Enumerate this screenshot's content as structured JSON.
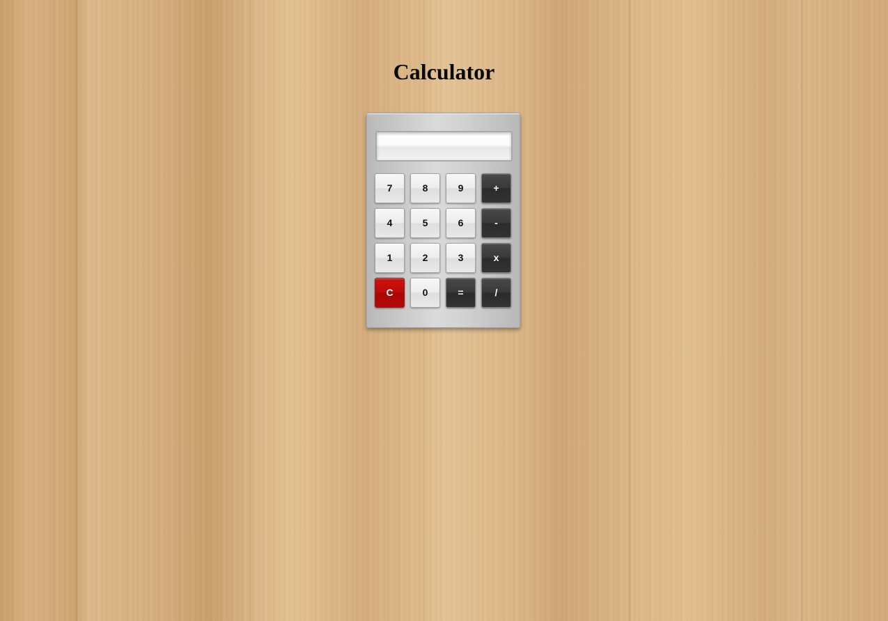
{
  "page": {
    "title": "Calculator"
  },
  "calculator": {
    "display_value": "",
    "keys": [
      {
        "label": "7",
        "style": "light"
      },
      {
        "label": "8",
        "style": "light"
      },
      {
        "label": "9",
        "style": "light"
      },
      {
        "label": "+",
        "style": "dark"
      },
      {
        "label": "4",
        "style": "light"
      },
      {
        "label": "5",
        "style": "light"
      },
      {
        "label": "6",
        "style": "light"
      },
      {
        "label": "-",
        "style": "dark"
      },
      {
        "label": "1",
        "style": "light"
      },
      {
        "label": "2",
        "style": "light"
      },
      {
        "label": "3",
        "style": "light"
      },
      {
        "label": "x",
        "style": "dark"
      },
      {
        "label": "C",
        "style": "red"
      },
      {
        "label": "0",
        "style": "light"
      },
      {
        "label": "=",
        "style": "dark"
      },
      {
        "label": "/",
        "style": "dark"
      }
    ]
  },
  "colors": {
    "clear_key": "#bd0909",
    "operator_key": "#333333",
    "digit_key": "#ededed"
  }
}
